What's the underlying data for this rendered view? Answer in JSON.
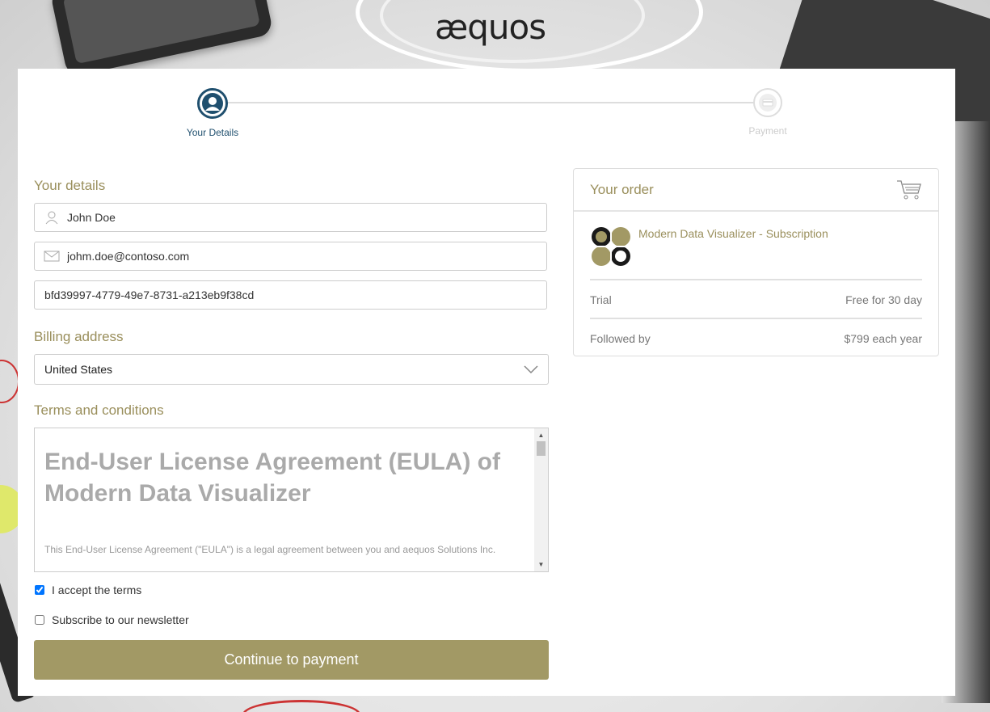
{
  "brand": {
    "logo_text": "æquos"
  },
  "stepper": {
    "steps": [
      {
        "label": "Your Details",
        "state": "active",
        "icon": "user-icon"
      },
      {
        "label": "Payment",
        "state": "inactive",
        "icon": "credit-card-icon"
      }
    ]
  },
  "details": {
    "title": "Your details",
    "name_value": "John Doe",
    "email_value": "johm.doe@contoso.com",
    "id_value": "bfd39997-4779-49e7-8731-a213eb9f38cd"
  },
  "billing": {
    "title": "Billing address",
    "country": "United States"
  },
  "terms": {
    "title": "Terms and conditions",
    "heading": "End-User License Agreement (EULA) of Modern Data Visualizer",
    "body": "This End-User License Agreement (\"EULA\") is a legal agreement between you and aequos Solutions Inc."
  },
  "checkboxes": {
    "accept_label": "I accept the terms",
    "accept_checked": true,
    "newsletter_label": "Subscribe to our newsletter",
    "newsletter_checked": false
  },
  "cta": {
    "label": "Continue to payment"
  },
  "order": {
    "title": "Your order",
    "product_name": "Modern Data Visualizer - Subscription",
    "rows": [
      {
        "label": "Trial",
        "value": "Free for 30 day"
      },
      {
        "label": "Followed by",
        "value": "$799 each year"
      }
    ]
  },
  "colors": {
    "accent": "#9a8f5c",
    "button": "#a29965",
    "step_active": "#1f4f6e"
  }
}
